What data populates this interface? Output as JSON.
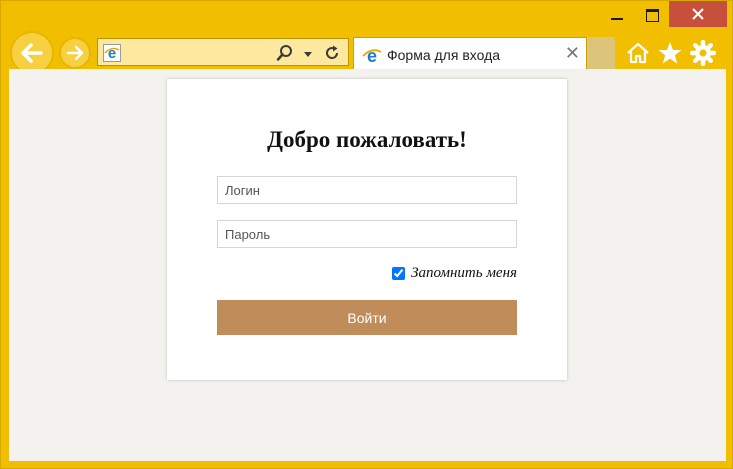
{
  "window": {
    "caption_buttons": {
      "minimize": "minimize-icon",
      "maximize": "maximize-icon",
      "close": "close-icon"
    },
    "close_glyph": "✕"
  },
  "toolbar": {
    "address_value": "",
    "tab_title": "Форма для входа",
    "tab_close_glyph": "✕",
    "icons": [
      "back-icon",
      "forward-icon",
      "ie-icon",
      "search-icon",
      "dropdown-icon",
      "refresh-icon",
      "home-icon",
      "favorites-star-icon",
      "settings-gear-icon"
    ]
  },
  "form": {
    "heading": "Добро пожаловать!",
    "login_placeholder": "Логин",
    "password_placeholder": "Пароль",
    "remember_label": "Запомнить меня",
    "remember_checked": true,
    "submit_label": "Войти"
  },
  "colors": {
    "frame": "#f2bf00",
    "close_button": "#c7503c",
    "submit_button": "#bf8c5a",
    "page_background": "#f3f2ee"
  }
}
